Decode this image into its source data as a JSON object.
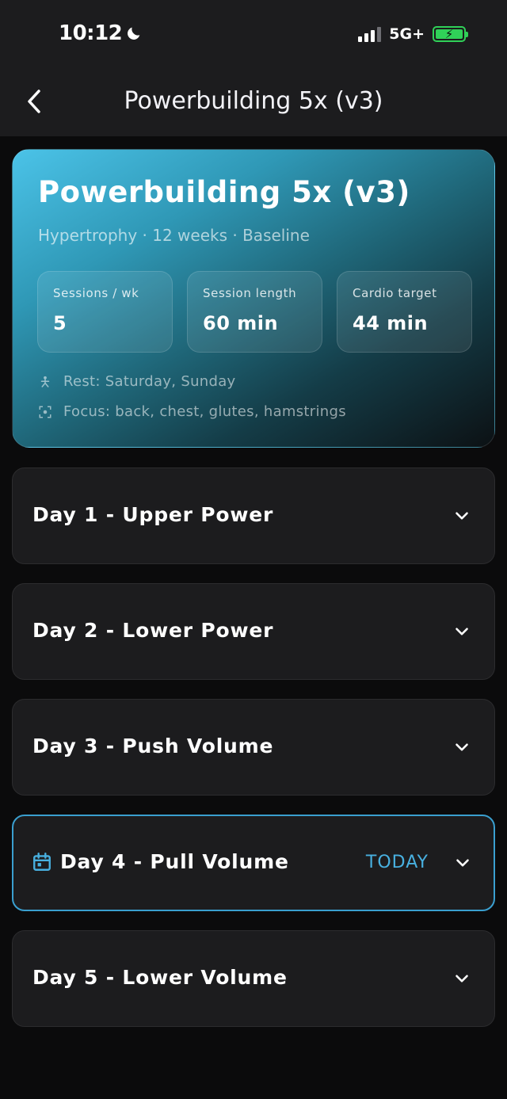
{
  "status_bar": {
    "time": "10:12",
    "network": "5G+"
  },
  "nav": {
    "title": "Powerbuilding 5x (v3)",
    "back_icon": "chevron-left-icon"
  },
  "program": {
    "title": "Powerbuilding 5x (v3)",
    "subtitle": "Hypertrophy · 12 weeks · Baseline",
    "stats": [
      {
        "label": "Sessions / wk",
        "value": "5"
      },
      {
        "label": "Session length",
        "value": "60 min"
      },
      {
        "label": "Cardio target",
        "value": "44 min"
      }
    ],
    "rest": "Rest: Saturday, Sunday",
    "focus": "Focus: back, chest, glutes, hamstrings"
  },
  "days": [
    {
      "title": "Day 1 - Upper Power"
    },
    {
      "title": "Day 2 - Lower Power"
    },
    {
      "title": "Day 3 - Push Volume"
    },
    {
      "title": "Day 4 - Pull Volume",
      "badge": "TODAY"
    },
    {
      "title": "Day 5 - Lower Volume"
    }
  ],
  "colors": {
    "accent": "#48b0e0",
    "card": "#1c1c1e",
    "battery": "#30d158"
  }
}
